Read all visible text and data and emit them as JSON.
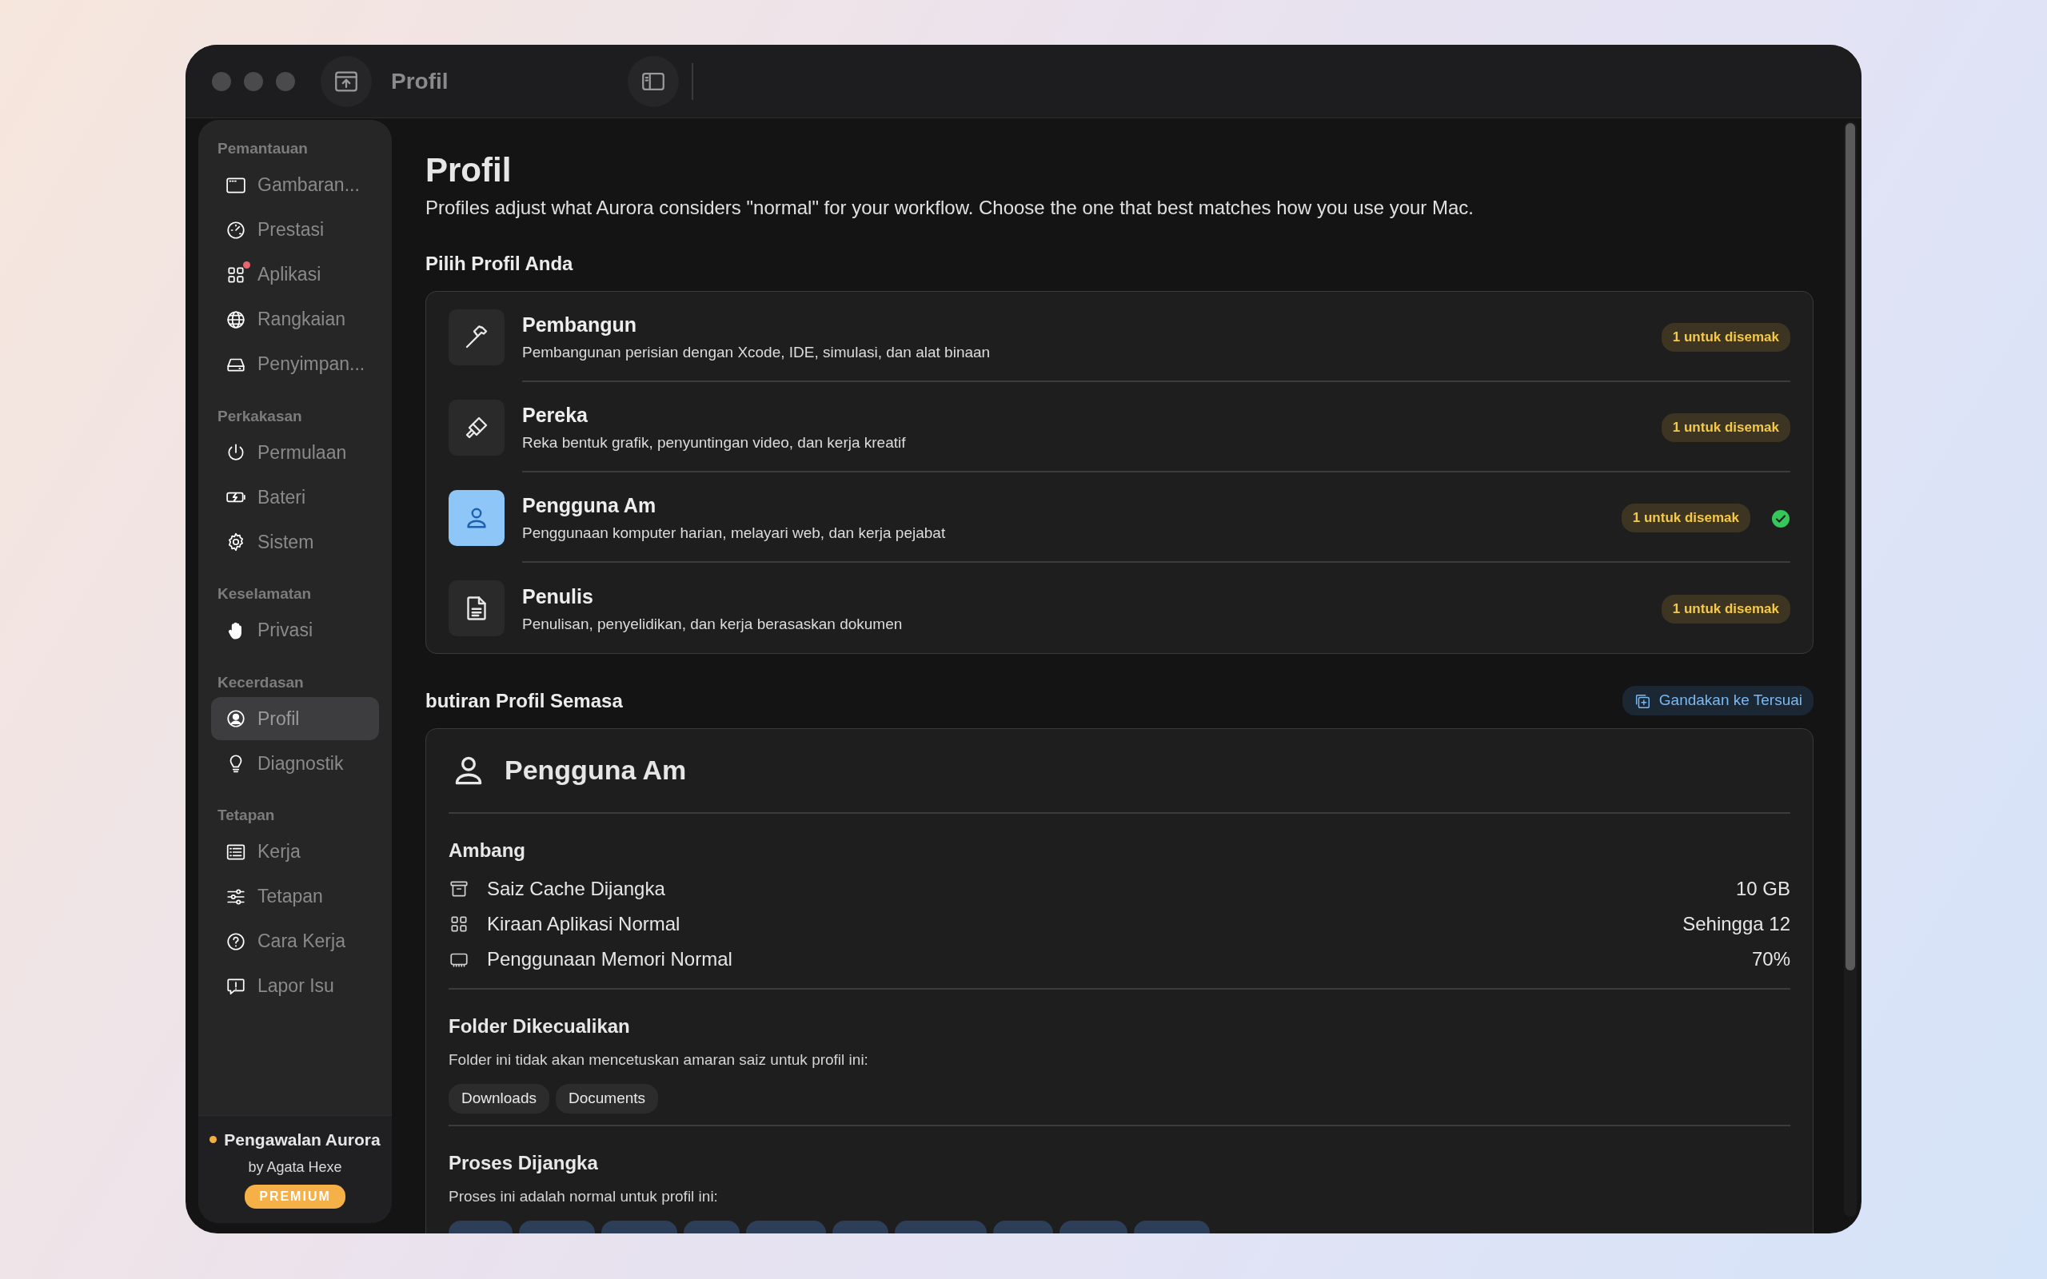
{
  "window": {
    "title": "Profil"
  },
  "sidebar": {
    "sections": [
      {
        "heading": "Pemantauan",
        "items": [
          {
            "label": "Gambaran...",
            "kind": "window",
            "selected": false,
            "alert": false
          },
          {
            "label": "Prestasi",
            "kind": "gauge",
            "selected": false,
            "alert": false
          },
          {
            "label": "Aplikasi",
            "kind": "grid",
            "selected": false,
            "alert": true
          },
          {
            "label": "Rangkaian",
            "kind": "globe",
            "selected": false,
            "alert": false
          },
          {
            "label": "Penyimpan...",
            "kind": "drive",
            "selected": false,
            "alert": false
          }
        ]
      },
      {
        "heading": "Perkakasan",
        "items": [
          {
            "label": "Permulaan",
            "kind": "power",
            "selected": false,
            "alert": false
          },
          {
            "label": "Bateri",
            "kind": "battery",
            "selected": false,
            "alert": false
          },
          {
            "label": "Sistem",
            "kind": "gear",
            "selected": false,
            "alert": false
          }
        ]
      },
      {
        "heading": "Keselamatan",
        "items": [
          {
            "label": "Privasi",
            "kind": "hand",
            "selected": false,
            "alert": false
          }
        ]
      },
      {
        "heading": "Kecerdasan",
        "items": [
          {
            "label": "Profil",
            "kind": "account",
            "selected": true,
            "alert": false
          },
          {
            "label": "Diagnostik",
            "kind": "bulb",
            "selected": false,
            "alert": false
          }
        ]
      },
      {
        "heading": "Tetapan",
        "items": [
          {
            "label": "Kerja",
            "kind": "list",
            "selected": false,
            "alert": false
          },
          {
            "label": "Tetapan",
            "kind": "sliders",
            "selected": false,
            "alert": false
          },
          {
            "label": "Cara Kerja",
            "kind": "question",
            "selected": false,
            "alert": false
          },
          {
            "label": "Lapor Isu",
            "kind": "report",
            "selected": false,
            "alert": false
          }
        ]
      }
    ],
    "footer": {
      "title": "Pengawalan Aurora",
      "author": "by Agata Hexe",
      "badge": "PREMIUM"
    }
  },
  "page": {
    "title": "Profil",
    "description": "Profiles adjust what Aurora considers \"normal\" for your workflow. Choose the one that best matches how you use your Mac.",
    "profiles_heading": "Pilih Profil Anda",
    "profiles": [
      {
        "name": "Pembangun",
        "description": "Pembangunan perisian dengan Xcode, IDE, simulasi, dan alat binaan",
        "badge": "1 untuk disemak",
        "kind": "hammer",
        "selected": false
      },
      {
        "name": "Pereka",
        "description": "Reka bentuk grafik, penyuntingan video, dan kerja kreatif",
        "badge": "1 untuk disemak",
        "kind": "brush",
        "selected": false
      },
      {
        "name": "Pengguna Am",
        "description": "Penggunaan komputer harian, melayari web, dan kerja pejabat",
        "badge": "1 untuk disemak",
        "kind": "person",
        "selected": true
      },
      {
        "name": "Penulis",
        "description": "Penulisan, penyelidikan, dan kerja berasaskan dokumen",
        "badge": "1 untuk disemak",
        "kind": "document",
        "selected": false
      }
    ]
  },
  "details": {
    "heading": "butiran Profil Semasa",
    "action": "Gandakan ke Tersuai",
    "profile_name": "Pengguna Am",
    "thresholds_heading": "Ambang",
    "thresholds": [
      {
        "label": "Saiz Cache Dijangka",
        "value": "10 GB",
        "kind": "archive"
      },
      {
        "label": "Kiraan Aplikasi Normal",
        "value": "Sehingga 12",
        "kind": "grid"
      },
      {
        "label": "Penggunaan Memori Normal",
        "value": "70%",
        "kind": "memory"
      }
    ],
    "excluded_heading": "Folder Dikecualikan",
    "excluded_note": "Folder ini tidak akan mencetuskan amaran saiz untuk profil ini:",
    "folders": [
      "Downloads",
      "Documents"
    ],
    "processes_heading": "Proses Dijangka",
    "processes_note": "Proses ini adalah normal untuk profil ini:"
  }
}
